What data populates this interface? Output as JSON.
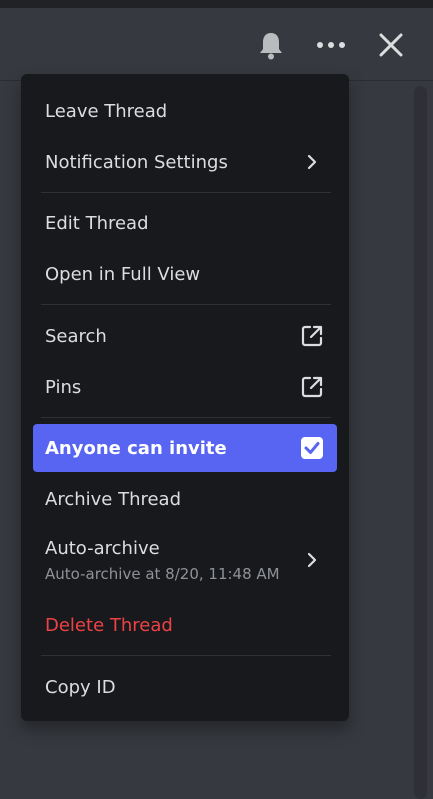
{
  "menu": {
    "leave_thread": "Leave Thread",
    "notification_settings": "Notification Settings",
    "edit_thread": "Edit Thread",
    "open_full_view": "Open in Full View",
    "search": "Search",
    "pins": "Pins",
    "anyone_can_invite": "Anyone can invite",
    "archive_thread": "Archive Thread",
    "auto_archive": "Auto-archive",
    "auto_archive_sub": "Auto-archive at 8/20, 11:48 AM",
    "delete_thread": "Delete Thread",
    "copy_id": "Copy ID"
  },
  "state": {
    "anyone_can_invite_checked": true
  },
  "icons": {
    "header": [
      "bell-icon",
      "more-icon",
      "close-icon"
    ],
    "menu": [
      "chevron-right-icon",
      "external-link-icon",
      "checkbox-checked-icon"
    ]
  },
  "colors": {
    "background": "#36393f",
    "menu_bg": "#18191c",
    "accent": "#5865f2",
    "danger": "#ed4245",
    "text": "#dcddde",
    "muted": "#8e9297"
  }
}
